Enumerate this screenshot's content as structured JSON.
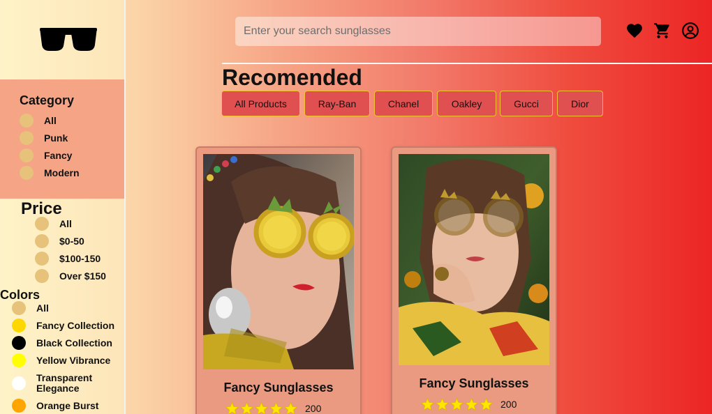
{
  "header": {
    "search_placeholder": "Enter your search sunglasses",
    "icons": [
      "heart-icon",
      "cart-icon",
      "user-icon"
    ]
  },
  "sidebar": {
    "logo_icon": "sunglasses-icon",
    "category": {
      "title": "Category",
      "items": [
        "All",
        "Punk",
        "Fancy",
        "Modern"
      ]
    },
    "price": {
      "title": "Price",
      "items": [
        "All",
        "$0-50",
        "$100-150",
        "Over $150"
      ]
    },
    "colors": {
      "title": "Colors",
      "items": [
        {
          "label": "All",
          "color": "#e6c27a"
        },
        {
          "label": "Fancy Collection",
          "color": "#ffd700"
        },
        {
          "label": "Black Collection",
          "color": "#000000"
        },
        {
          "label": "Yellow Vibrance",
          "color": "#ffff00"
        },
        {
          "label": "Transparent Elegance",
          "color": "#ffffff"
        },
        {
          "label": "Orange Burst",
          "color": "#ffa500"
        }
      ]
    }
  },
  "main": {
    "title": "Recomended",
    "filters": [
      "All Products",
      "Ray-Ban",
      "Chanel",
      "Oakley",
      "Gucci",
      "Dior"
    ],
    "products": [
      {
        "name": "Fancy Sunglasses",
        "rating": 5,
        "price": "200"
      },
      {
        "name": "Fancy Sunglasses",
        "rating": 5,
        "price": "200"
      }
    ]
  },
  "colors": {
    "sidebar_accent": "#f5a586",
    "filter_button": "#e05050",
    "filter_border": "#f2c232",
    "star": "#ffe600"
  }
}
